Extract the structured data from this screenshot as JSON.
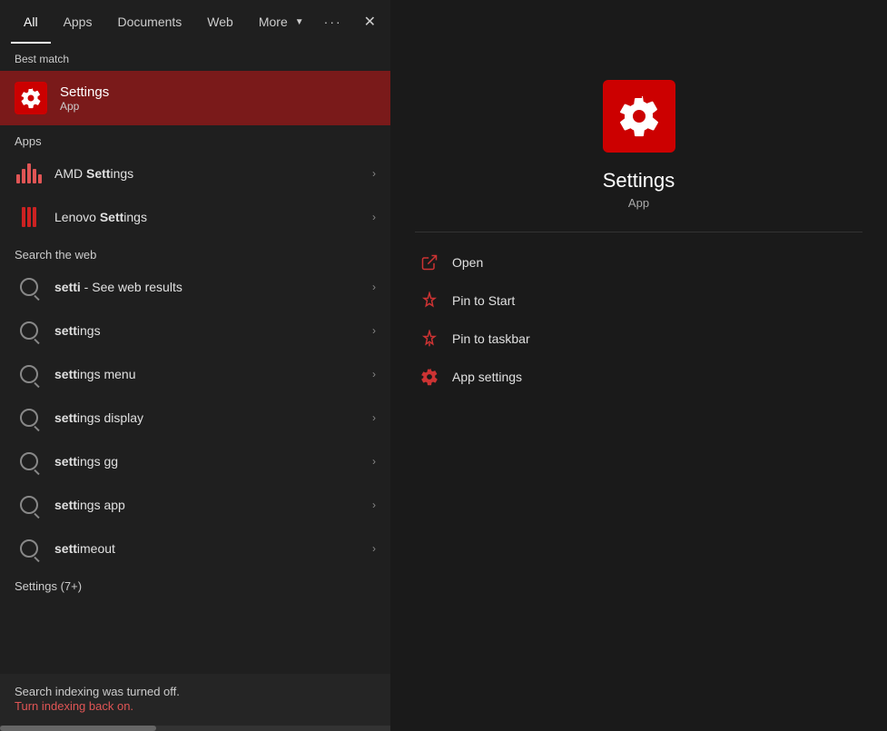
{
  "tabs": {
    "items": [
      {
        "id": "all",
        "label": "All",
        "active": true
      },
      {
        "id": "apps",
        "label": "Apps",
        "active": false
      },
      {
        "id": "documents",
        "label": "Documents",
        "active": false
      },
      {
        "id": "web",
        "label": "Web",
        "active": false
      },
      {
        "id": "more",
        "label": "More",
        "active": false
      }
    ],
    "more_chevron": "▼",
    "ellipsis": "···",
    "close": "✕"
  },
  "best_match": {
    "section_label": "Best match",
    "title": "Settings",
    "subtitle": "App"
  },
  "apps_section": {
    "label": "Apps",
    "items": [
      {
        "label_prefix": "AMD ",
        "label_bold": "Sett",
        "label_suffix": "ings"
      },
      {
        "label_prefix": "Lenovo ",
        "label_bold": "Sett",
        "label_suffix": "ings"
      }
    ]
  },
  "web_section": {
    "label": "Search the web",
    "items": [
      {
        "label_prefix": "setti",
        "label_suffix": " - See web results"
      },
      {
        "label_full": "settings"
      },
      {
        "label_full": "settings menu"
      },
      {
        "label_full": "settings display"
      },
      {
        "label_full": "settings gg"
      },
      {
        "label_full": "settings app"
      },
      {
        "label_full": "settimeout"
      }
    ]
  },
  "settings_group": {
    "label": "Settings (7+)"
  },
  "bottom_bar": {
    "message": "Search indexing was turned off.",
    "link_text": "Turn indexing back on."
  },
  "detail_panel": {
    "app_title": "Settings",
    "app_subtitle": "App",
    "actions": [
      {
        "id": "open",
        "label": "Open"
      },
      {
        "id": "pin_start",
        "label": "Pin to Start"
      },
      {
        "id": "pin_taskbar",
        "label": "Pin to taskbar"
      },
      {
        "id": "app_settings",
        "label": "App settings"
      }
    ]
  }
}
